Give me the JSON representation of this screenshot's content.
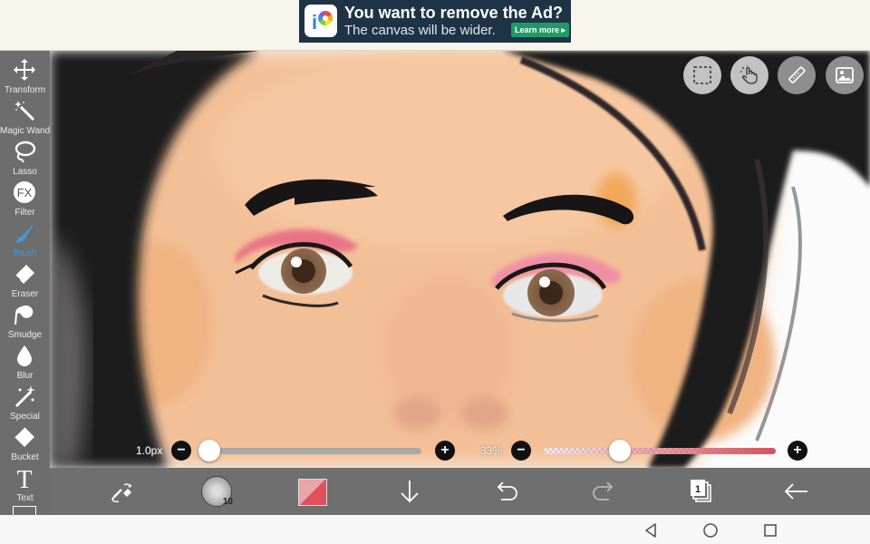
{
  "ad": {
    "title": "You want to remove the Ad?",
    "subtitle": "The canvas will be wider.",
    "cta": "Learn more ▸"
  },
  "tools": [
    {
      "label": "Transform",
      "icon": "move-arrows-icon"
    },
    {
      "label": "Magic Wand",
      "icon": "magic-wand-icon"
    },
    {
      "label": "Lasso",
      "icon": "lasso-icon"
    },
    {
      "label": "Filter",
      "icon": "fx-icon"
    },
    {
      "label": "Brush",
      "icon": "brush-icon",
      "active": true
    },
    {
      "label": "Eraser",
      "icon": "eraser-icon"
    },
    {
      "label": "Smudge",
      "icon": "smudge-icon"
    },
    {
      "label": "Blur",
      "icon": "drop-icon"
    },
    {
      "label": "Special",
      "icon": "sparkle-wand-icon"
    },
    {
      "label": "Bucket",
      "icon": "bucket-icon"
    },
    {
      "label": "Text",
      "icon": "text-t-icon"
    }
  ],
  "fx_glyph": "FX",
  "text_glyph": "T",
  "sliders": {
    "size": {
      "label": "1.0px",
      "minus": "−",
      "plus": "+",
      "fraction": 0.0
    },
    "opacity": {
      "label": "33%",
      "minus": "−",
      "plus": "+",
      "percent": 33
    }
  },
  "bottom": {
    "brush_size_badge": "10",
    "layer_count": "1",
    "primary_color": "#e0505a"
  },
  "colors": {
    "toolbar": "#6d6d6d",
    "active_tool": "#3d9ae8",
    "opacity_track": "#d8505e",
    "size_track": "#a9a9a9"
  }
}
